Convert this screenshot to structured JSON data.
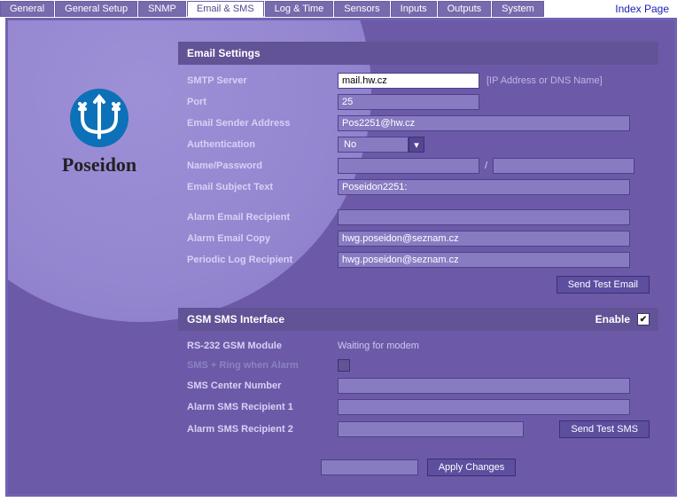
{
  "index_link": "Index Page",
  "tabs": [
    {
      "label": "General"
    },
    {
      "label": "General Setup"
    },
    {
      "label": "SNMP"
    },
    {
      "label": "Email & SMS",
      "active": true
    },
    {
      "label": "Log & Time"
    },
    {
      "label": "Sensors"
    },
    {
      "label": "Inputs"
    },
    {
      "label": "Outputs"
    },
    {
      "label": "System"
    }
  ],
  "logo_name": "Poseidon",
  "email": {
    "title": "Email Settings",
    "smtp_label": "SMTP Server",
    "smtp_value": "mail.hw.cz",
    "smtp_hint": "[IP Address or DNS Name]",
    "port_label": "Port",
    "port_value": "25",
    "sender_label": "Email Sender Address",
    "sender_value": "Pos2251@hw.cz",
    "auth_label": "Authentication",
    "auth_value": "No",
    "np_label": "Name/Password",
    "np_name": "",
    "np_sep": "/",
    "np_pass": "",
    "subject_label": "Email Subject Text",
    "subject_value": "Poseidon2251:",
    "alarm_rcpt_label": "Alarm Email Recipient",
    "alarm_rcpt_value": "",
    "alarm_copy_label": "Alarm Email Copy",
    "alarm_copy_value": "hwg.poseidon@seznam.cz",
    "periodic_label": "Periodic Log Recipient",
    "periodic_value": "hwg.poseidon@seznam.cz",
    "test_btn": "Send Test Email"
  },
  "sms": {
    "title": "GSM SMS Interface",
    "enable_label": "Enable",
    "enable_checked": true,
    "rs232_label": "RS-232 GSM Module",
    "rs232_status": "Waiting for modem",
    "smsring_label": "SMS + Ring when Alarm",
    "center_label": "SMS Center Number",
    "center_value": "",
    "r1_label": "Alarm SMS Recipient 1",
    "r1_value": "",
    "r2_label": "Alarm SMS Recipient 2",
    "r2_value": "",
    "test_btn": "Send Test SMS"
  },
  "apply_btn": "Apply Changes"
}
